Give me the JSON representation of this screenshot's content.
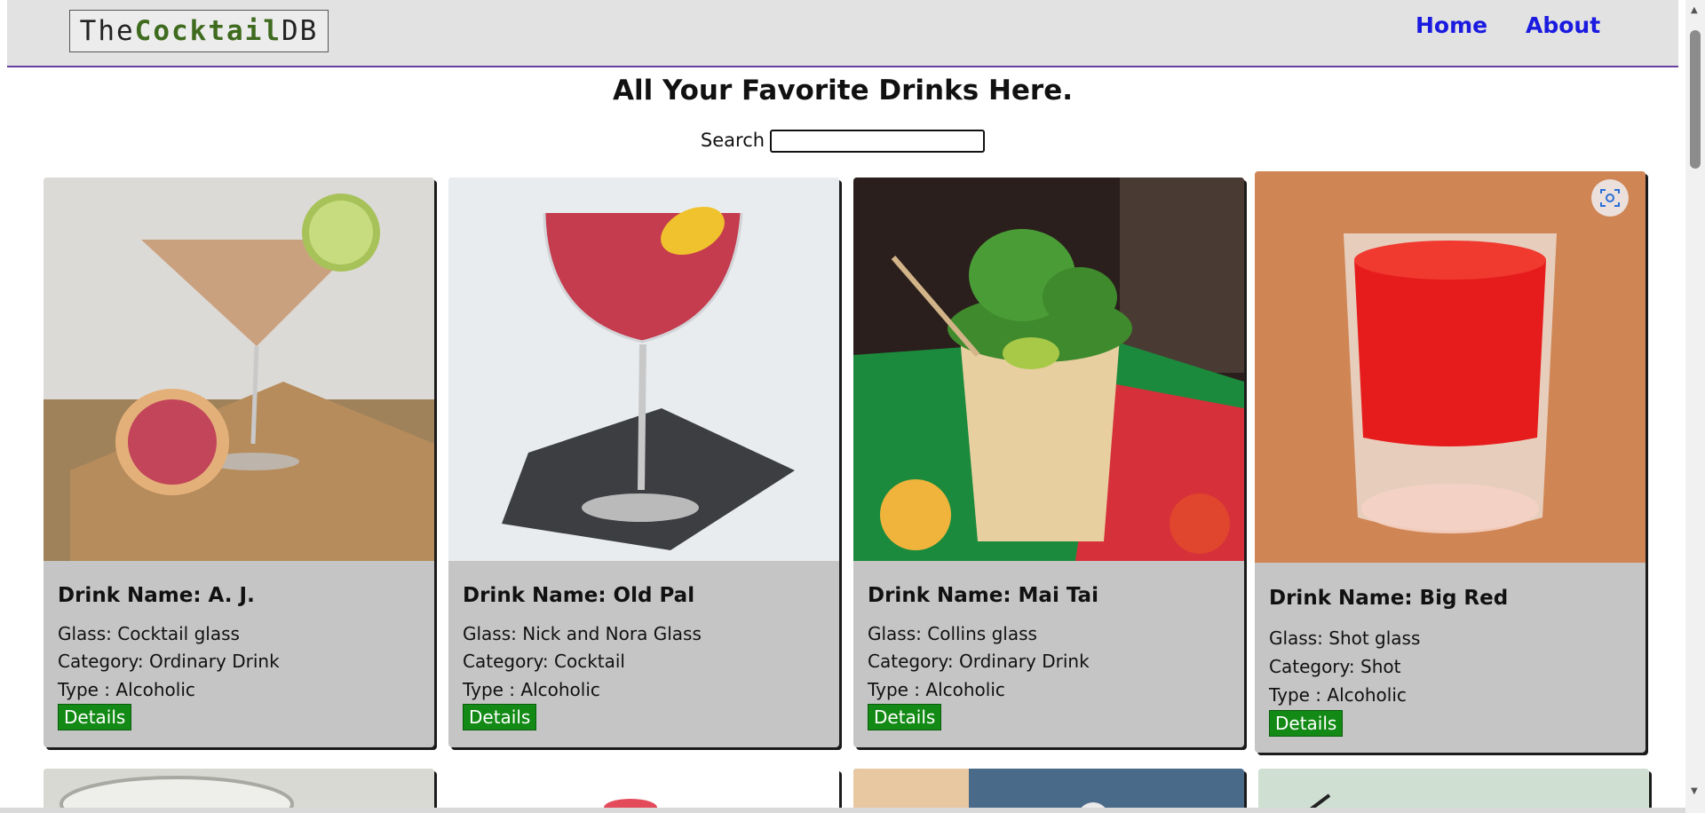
{
  "nav": {
    "logo_prefix": "The",
    "logo_mid": "Cocktail",
    "logo_suffix": "DB",
    "links": [
      "Home",
      "About"
    ]
  },
  "main": {
    "title": "All Your Favorite Drinks Here.",
    "search_label": "Search",
    "search_value": ""
  },
  "cards": [
    {
      "name": "Drink Name: A. J.",
      "glass": "Glass: Cocktail glass",
      "category": "Category: Ordinary Drink",
      "type": "Type : Alcoholic",
      "details": "Details"
    },
    {
      "name": "Drink Name: Old Pal",
      "glass": "Glass: Nick and Nora Glass",
      "category": "Category: Cocktail",
      "type": "Type : Alcoholic",
      "details": "Details"
    },
    {
      "name": "Drink Name: Mai Tai",
      "glass": "Glass: Collins glass",
      "category": "Category: Ordinary Drink",
      "type": "Type : Alcoholic",
      "details": "Details"
    },
    {
      "name": "Drink Name: Big Red",
      "glass": "Glass: Shot glass",
      "category": "Category: Shot",
      "type": "Type : Alcoholic",
      "details": "Details"
    }
  ],
  "colors": {
    "nav_link": "#1a1ae0",
    "details_button": "#138a15",
    "card_bg": "#c5c5c5",
    "nav_border": "#6a3fa0"
  },
  "icons": [
    "visual-search-icon",
    "scroll-up-icon",
    "scroll-down-icon"
  ]
}
